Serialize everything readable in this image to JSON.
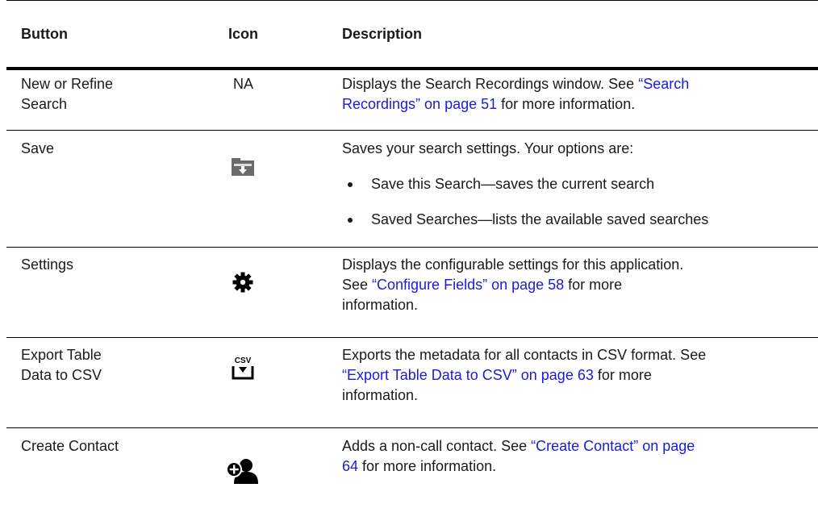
{
  "headers": {
    "button": "Button",
    "icon": "Icon",
    "description": "Description"
  },
  "rows": [
    {
      "button": [
        "New or Refine",
        "Search"
      ],
      "icon_text": "NA",
      "desc": {
        "line1_pre": "Displays the Search Recordings window. See ",
        "line1_link": "“Search",
        "line2_link": "Recordings” on page 51",
        "line2_post": " for more information."
      }
    },
    {
      "button": [
        "Save"
      ],
      "icon": "save-folder-icon",
      "desc": {
        "line1": "Saves your search settings. Your options are:",
        "bullets": [
          "Save this Search—saves the current search",
          "Saved Searches—lists the available saved searches"
        ]
      }
    },
    {
      "button": [
        "Settings"
      ],
      "icon": "gear-icon",
      "desc": {
        "line1": "Displays the configurable settings for this application.",
        "line2_pre": "See ",
        "line2_link": "“Configure Fields” on page 58",
        "line2_post": " for more",
        "line3": "information."
      }
    },
    {
      "button": [
        "Export Table",
        "Data to CSV"
      ],
      "icon": "csv-export-icon",
      "icon_label": "CSV",
      "desc": {
        "line1": "Exports the metadata for all contacts in CSV format. See",
        "line2_link": "“Export Table Data to CSV” on page 63",
        "line2_post": " for more",
        "line3": "information."
      }
    },
    {
      "button": [
        "Create Contact"
      ],
      "icon": "add-contact-icon",
      "desc": {
        "line1_pre": "Adds a non-call contact. See ",
        "line1_link": "“Create Contact” on page",
        "line2_link": "64",
        "line2_post": " for more information."
      }
    }
  ]
}
